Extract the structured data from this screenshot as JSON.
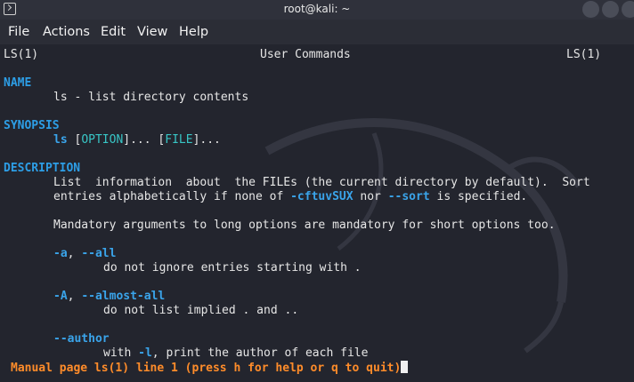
{
  "window": {
    "title": "root@kali: ~",
    "icon": "terminal-icon"
  },
  "menubar": {
    "items": [
      "File",
      "Actions",
      "Edit",
      "View",
      "Help"
    ]
  },
  "man": {
    "header_left": "LS(1)",
    "header_center": "User Commands",
    "header_right": "LS(1)",
    "name_heading": "NAME",
    "name_text": "ls - list directory contents",
    "synopsis_heading": "SYNOPSIS",
    "synopsis": {
      "cmd": "ls",
      "open1": " [",
      "opt": "OPTION",
      "close1": "]... [",
      "file": "FILE",
      "close2": "]..."
    },
    "description_heading": "DESCRIPTION",
    "desc_line1": "List  information  about  the FILEs (the current directory by default).  Sort",
    "desc_line2_a": "entries alphabetically if none of ",
    "desc_line2_b": "-cftuvSUX",
    "desc_line2_c": " nor ",
    "desc_line2_d": "--sort",
    "desc_line2_e": " is specified.",
    "mandatory": "Mandatory arguments to long options are mandatory for short options too.",
    "opt_a": "-a",
    "opt_a_sep": ", ",
    "opt_all": "--all",
    "opt_all_desc": "do not ignore entries starting with .",
    "opt_A": "-A",
    "opt_A_sep": ", ",
    "opt_almost": "--almost-all",
    "opt_almost_desc": "do not list implied . and ..",
    "opt_author": "--author",
    "author_desc_a": "with ",
    "author_desc_b": "-l",
    "author_desc_c": ", print the author of each file"
  },
  "status": {
    "prompt": "Manual page ls(1) line 1 (press h for help or q to quit)"
  },
  "colors": {
    "background": "#23252e",
    "heading": "#2d9ee6",
    "option": "#3aa4ea",
    "placeholder": "#38c6c6",
    "prompt": "#ff8c2a"
  }
}
